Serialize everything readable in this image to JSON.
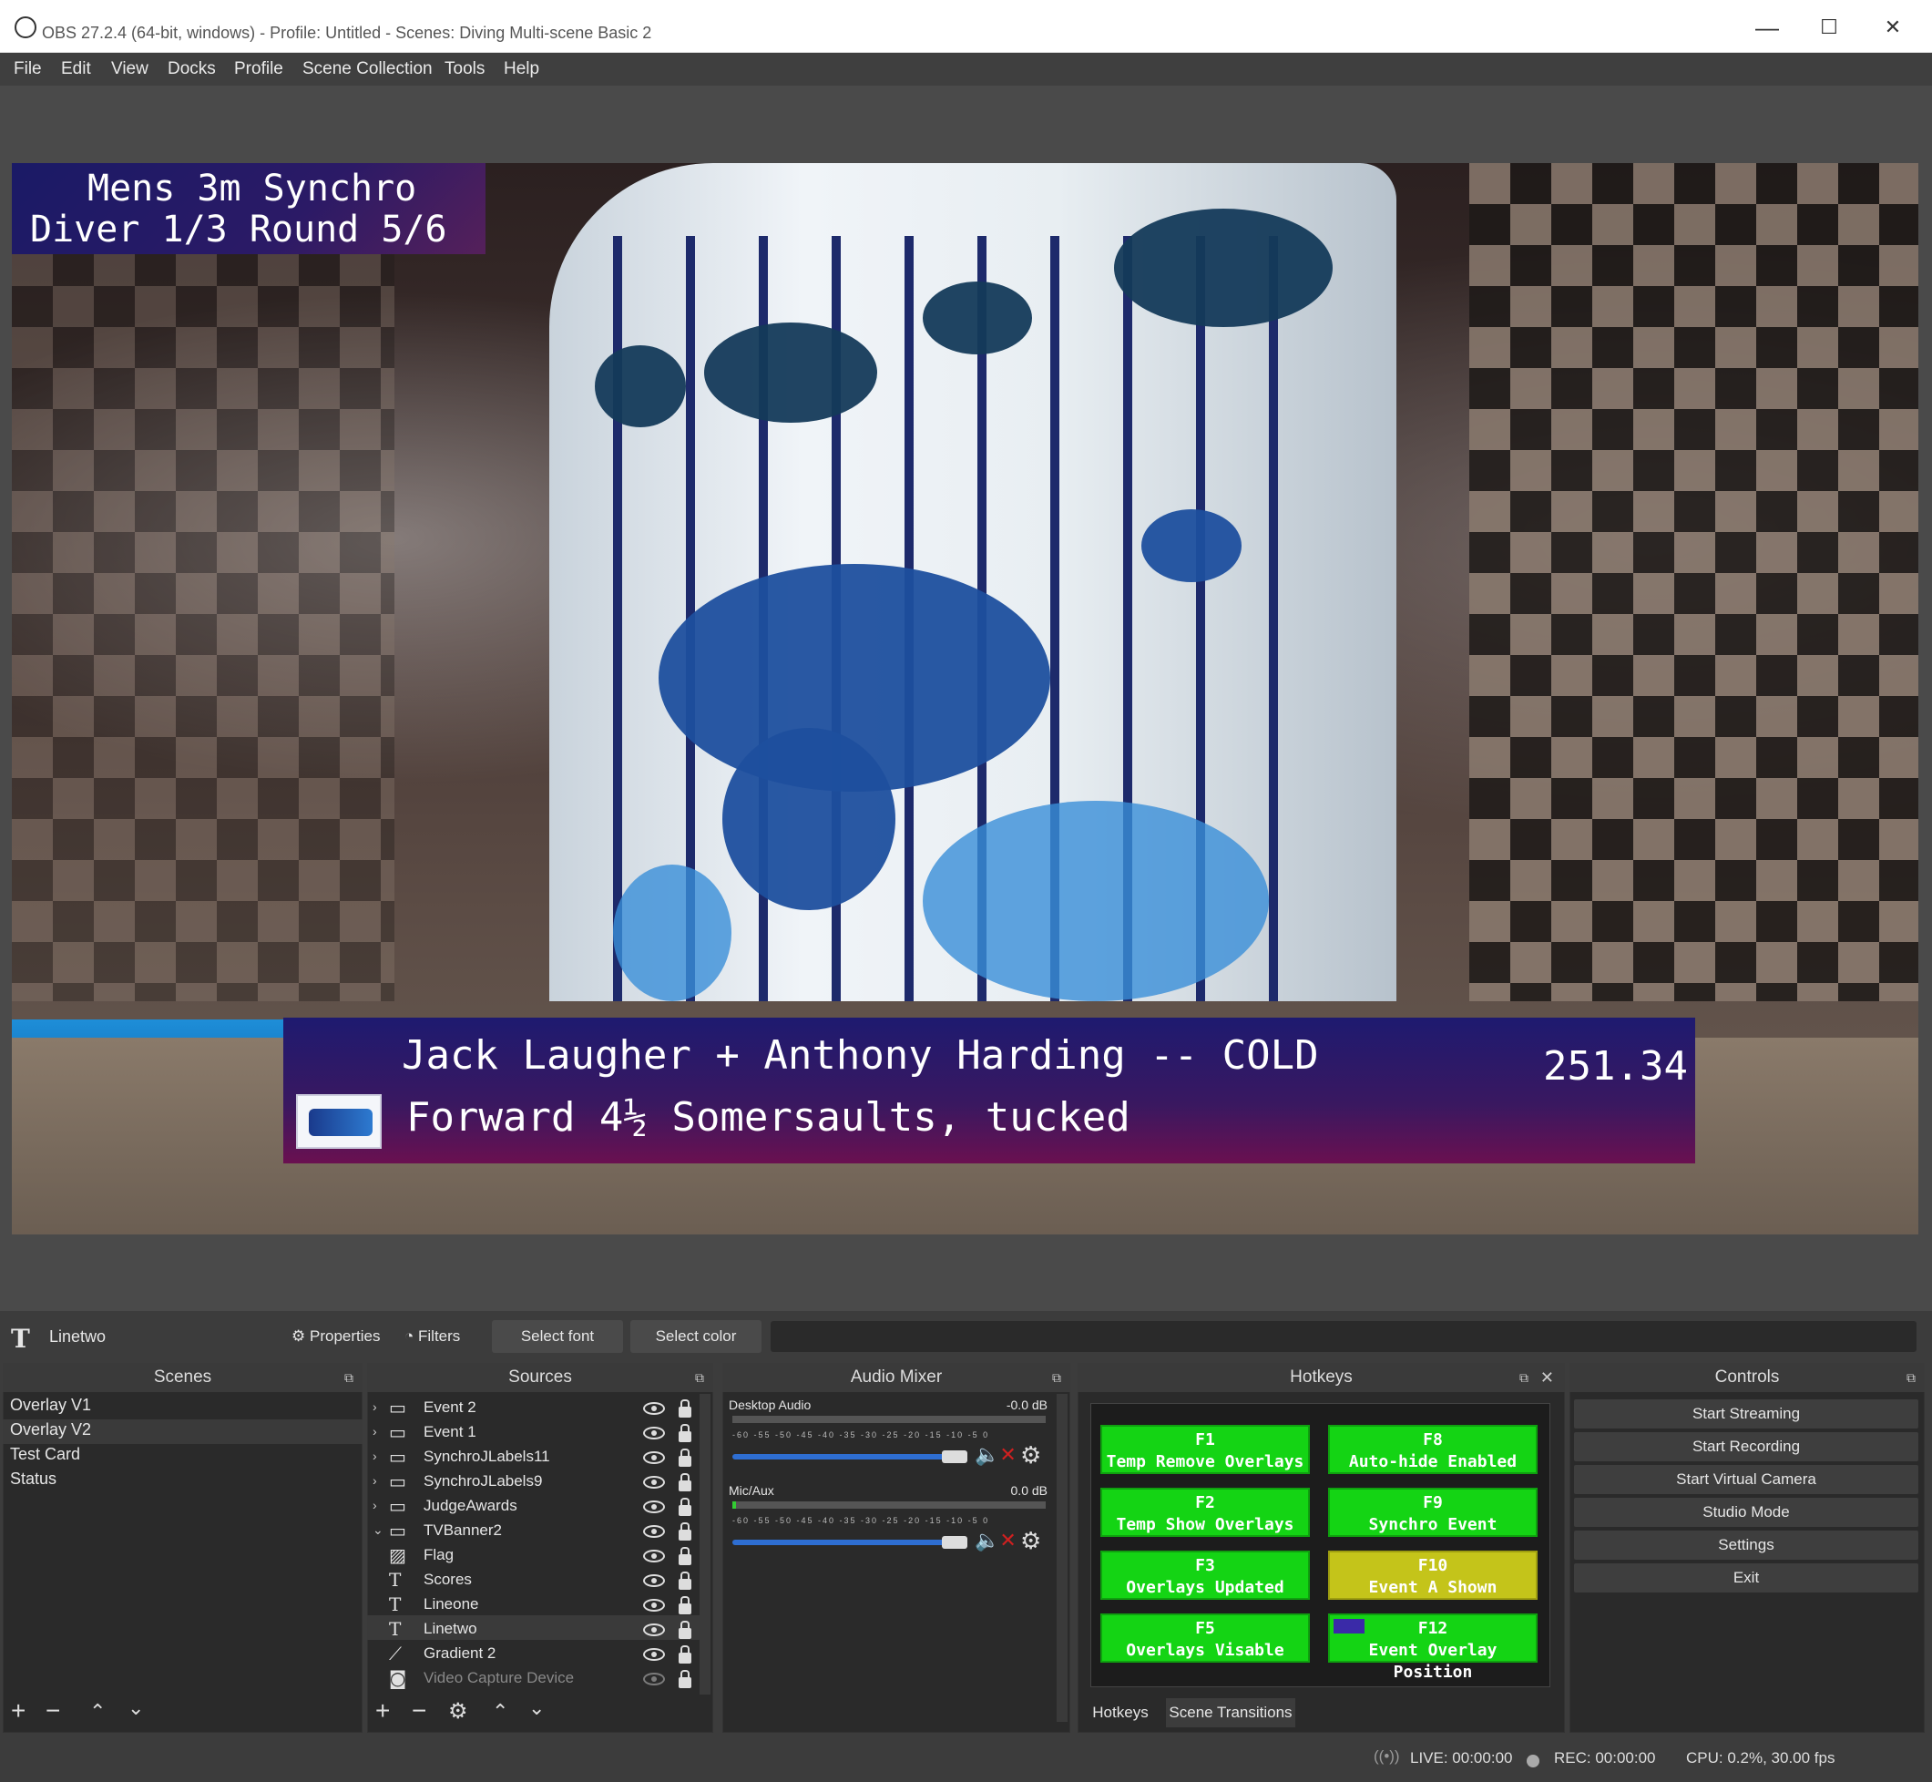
{
  "window": {
    "title": "OBS 27.2.4 (64-bit, windows) - Profile: Untitled - Scenes: Diving Multi-scene Basic 2",
    "controls": {
      "minimize": "—",
      "maximize": "☐",
      "close": "✕"
    }
  },
  "menu": [
    "File",
    "Edit",
    "View",
    "Docks",
    "Profile",
    "Scene Collection",
    "Tools",
    "Help"
  ],
  "preview": {
    "top_overlay": {
      "line1": "Mens 3m Synchro",
      "line2": "Diver 1/3  Round 5/6"
    },
    "bottom_overlay": {
      "line1": "Jack Laugher + Anthony Harding -- COLD",
      "line2": "Forward 4½ Somersaults, tucked",
      "score": "251.34"
    }
  },
  "source_toolbar": {
    "selected_source": "Linetwo",
    "properties": "Properties",
    "filters": "Filters",
    "select_font": "Select font",
    "select_color": "Select color"
  },
  "scenes": {
    "title": "Scenes",
    "items": [
      "Overlay V1",
      "Overlay V2",
      "Test Card",
      "Status"
    ],
    "selected": "Overlay V2"
  },
  "sources": {
    "title": "Sources",
    "items": [
      {
        "name": "Event 2",
        "type": "group",
        "expanded": false
      },
      {
        "name": "Event 1",
        "type": "group",
        "expanded": false
      },
      {
        "name": "SynchroJLabels11",
        "type": "group",
        "expanded": false
      },
      {
        "name": "SynchroJLabels9",
        "type": "group",
        "expanded": false
      },
      {
        "name": "JudgeAwards",
        "type": "group",
        "expanded": false
      },
      {
        "name": "TVBanner2",
        "type": "group",
        "expanded": true
      },
      {
        "name": "Flag",
        "type": "image"
      },
      {
        "name": "Scores",
        "type": "text"
      },
      {
        "name": "Lineone",
        "type": "text"
      },
      {
        "name": "Linetwo",
        "type": "text"
      },
      {
        "name": "Gradient 2",
        "type": "gradient"
      },
      {
        "name": "Video Capture Device",
        "type": "camera",
        "hidden": true
      }
    ]
  },
  "audio_mixer": {
    "title": "Audio Mixer",
    "ticks": "-60 -55 -50 -45 -40 -35 -30 -25 -20 -15 -10 -5 0",
    "channels": [
      {
        "name": "Desktop Audio",
        "level": "-0.0 dB",
        "volume": 1.0,
        "muted": true
      },
      {
        "name": "Mic/Aux",
        "level": "0.0 dB",
        "volume": 1.0,
        "muted": true
      }
    ]
  },
  "hotkeys": {
    "title": "Hotkeys",
    "buttons": [
      {
        "key": "F1",
        "label": "Temp Remove Overlays",
        "state": "green"
      },
      {
        "key": "F8",
        "label": "Auto-hide Enabled",
        "state": "green"
      },
      {
        "key": "F2",
        "label": "Temp Show Overlays",
        "state": "green"
      },
      {
        "key": "F9",
        "label": "Synchro Event",
        "state": "green"
      },
      {
        "key": "F3",
        "label": "Overlays Updated",
        "state": "green"
      },
      {
        "key": "F10",
        "label": "Event A Shown",
        "state": "yellow"
      },
      {
        "key": "F5",
        "label": "Overlays Visable",
        "state": "green"
      },
      {
        "key": "F12",
        "label": "Event Overlay Position",
        "state": "green"
      }
    ],
    "tabs": [
      "Hotkeys",
      "Scene Transitions"
    ]
  },
  "controls": {
    "title": "Controls",
    "buttons": [
      "Start Streaming",
      "Start Recording",
      "Start Virtual Camera",
      "Studio Mode",
      "Settings",
      "Exit"
    ]
  },
  "status": {
    "live": "LIVE: 00:00:00",
    "rec": "REC: 00:00:00",
    "cpu": "CPU: 0.2%, 30.00 fps"
  },
  "colors": {
    "hotkey_green": "#14d414",
    "hotkey_yellow": "#c4c41a",
    "overlay_blue": "#1e1a70",
    "overlay_purple": "#6a1050",
    "volume_blue": "#2e6ed2",
    "mute_red": "#d02020"
  }
}
